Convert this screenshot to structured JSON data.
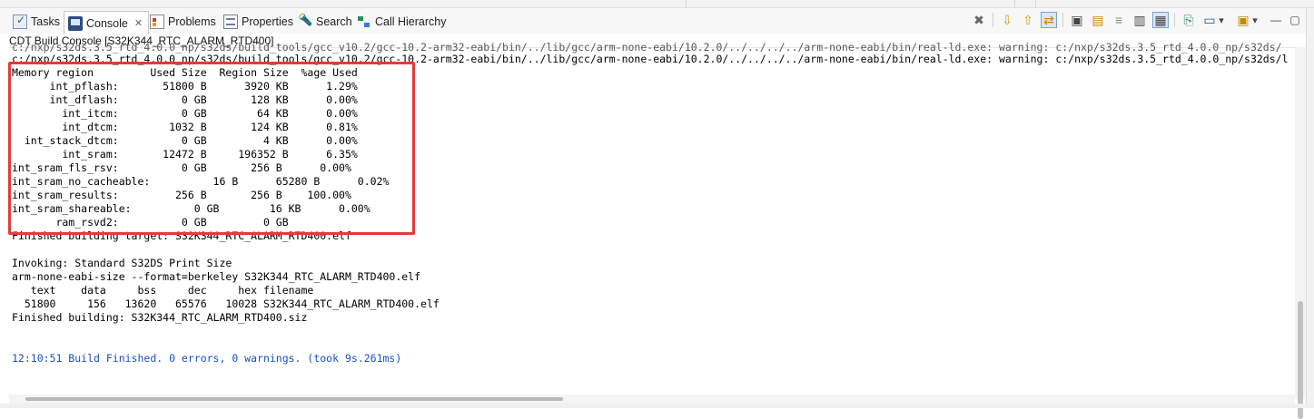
{
  "tabs": [
    {
      "label": "Tasks",
      "icon": "tasks-icon"
    },
    {
      "label": "Console",
      "icon": "console-icon",
      "active": true,
      "close": "✕"
    },
    {
      "label": "Problems",
      "icon": "problems-icon"
    },
    {
      "label": "Properties",
      "icon": "properties-icon"
    },
    {
      "label": "Search",
      "icon": "search-icon"
    },
    {
      "label": "Call Hierarchy",
      "icon": "call-hierarchy-icon"
    }
  ],
  "toolbar": {
    "clear_glyph": "✖",
    "next_glyph": "⇩",
    "prev_glyph": "⇧",
    "scroll_lock_glyph": "⇄",
    "pin_glyph": "▣",
    "display_glyph": "▤",
    "word_wrap_glyph": "≡",
    "show_when_output_glyph": "▥",
    "show_when_error_glyph": "▦",
    "open_console_glyph": "⎘",
    "new_console_glyph": "▭",
    "minimize_glyph": "—",
    "maximize_glyph": "▢",
    "dropdown_glyph": "▾",
    "accent": "#7aa2d6"
  },
  "console": {
    "title": "CDT Build Console [S32K344_RTC_ALARM_RTD400]",
    "lines": [
      "c:/nxp/s32ds.3.5_rtd_4.0.0_np/s32ds/build_tools/gcc_v10.2/gcc-10.2-arm32-eabi/bin/../lib/gcc/arm-none-eabi/10.2.0/../../../../arm-none-eabi/bin/real-ld.exe: warning: c:/nxp/s32ds.3.5_rtd_4.0.0_np/s32ds/",
      "c:/nxp/s32ds.3.5_rtd_4.0.0_np/s32ds/build_tools/gcc_v10.2/gcc-10.2-arm32-eabi/bin/../lib/gcc/arm-none-eabi/10.2.0/../../../../arm-none-eabi/bin/real-ld.exe: warning: c:/nxp/s32ds.3.5_rtd_4.0.0_np/s32ds/l",
      "Memory region         Used Size  Region Size  %age Used",
      "      int_pflash:       51800 B      3920 KB      1.29%",
      "      int_dflash:          0 GB       128 KB      0.00%",
      "        int_itcm:          0 GB        64 KB      0.00%",
      "        int_dtcm:        1032 B       124 KB      0.81%",
      "  int_stack_dtcm:          0 GB         4 KB      0.00%",
      "        int_sram:       12472 B     196352 B      6.35%",
      "int_sram_fls_rsv:          0 GB       256 B      0.00%",
      "int_sram_no_cacheable:          16 B      65280 B      0.02%",
      "int_sram_results:         256 B       256 B    100.00%",
      "int_sram_shareable:          0 GB        16 KB      0.00%",
      "       ram_rsvd2:          0 GB         0 GB",
      "Finished building target: S32K344_RTC_ALARM_RTD400.elf",
      "",
      "Invoking: Standard S32DS Print Size",
      "arm-none-eabi-size --format=berkeley S32K344_RTC_ALARM_RTD400.elf",
      "   text    data     bss     dec     hex filename",
      "  51800     156   13620   65576   10028 S32K344_RTC_ALARM_RTD400.elf",
      "Finished building: S32K344_RTC_ALARM_RTD400.siz",
      "",
      "",
      "12:10:51 Build Finished. 0 errors, 0 warnings. (took 9s.261ms)"
    ],
    "highlight_color": "#e23b3b",
    "status_text_color": "#1a4fc4"
  }
}
